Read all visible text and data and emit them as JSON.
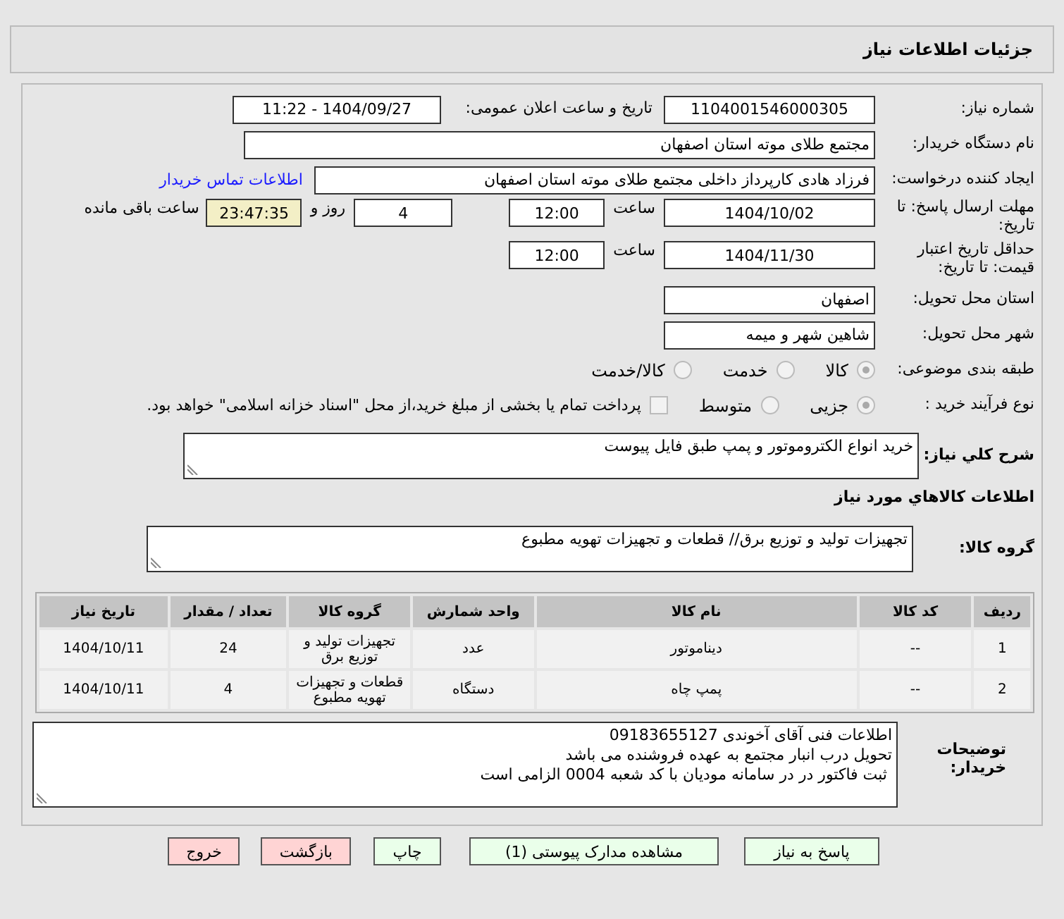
{
  "header": {
    "title": "جزئیات اطلاعات نیاز"
  },
  "need_number": {
    "label": "شماره نیاز:",
    "value": "1104001546000305"
  },
  "announce": {
    "label": "تاریخ و ساعت اعلان عمومی:",
    "value": "1404/09/27 - 11:22"
  },
  "buyer_org": {
    "label": "نام دستگاه خریدار:",
    "value": "مجتمع طلای موته استان اصفهان"
  },
  "requester": {
    "label": "ایجاد کننده درخواست:",
    "value": "فرزاد هادی کارپرداز داخلی مجتمع طلای موته استان اصفهان",
    "link": "اطلاعات تماس خریدار"
  },
  "reply_deadline": {
    "label": "مهلت ارسال پاسخ: تا تاریخ:",
    "date": "1404/10/02",
    "time_label": "ساعت",
    "time": "12:00",
    "days": "4",
    "days_label": "روز و",
    "remaining": "23:47:35",
    "remaining_label": "ساعت باقی مانده"
  },
  "price_validity": {
    "label": "حداقل تاریخ اعتبار قیمت: تا تاریخ:",
    "date": "1404/11/30",
    "time_label": "ساعت",
    "time": "12:00"
  },
  "province": {
    "label": "استان محل تحویل:",
    "value": "اصفهان"
  },
  "city": {
    "label": "شهر محل تحویل:",
    "value": "شاهین شهر و میمه"
  },
  "category": {
    "label": "طبقه بندی موضوعی:",
    "options": [
      {
        "label": "کالا",
        "selected": true
      },
      {
        "label": "خدمت",
        "selected": false
      },
      {
        "label": "کالا/خدمت",
        "selected": false
      }
    ]
  },
  "process": {
    "label": "نوع فرآیند خرید :",
    "options": [
      {
        "label": "جزیی",
        "selected": true
      },
      {
        "label": "متوسط",
        "selected": false
      }
    ],
    "treasury": {
      "label": "پرداخت تمام یا بخشی از مبلغ خرید،از محل \"اسناد خزانه اسلامی\" خواهد بود.",
      "checked": false
    }
  },
  "description": {
    "label": "شرح کلي نیاز:",
    "value": "خرید انواع الکتروموتور و پمپ طبق فایل پیوست"
  },
  "goods_section": {
    "title": "اطلاعات کالاهاي مورد نیاز"
  },
  "goods_group": {
    "label": "گروه کالا:",
    "value": "تجهیزات تولید و توزیع برق//  قطعات و تجهیزات تهویه مطبوع"
  },
  "table": {
    "columns": [
      "ردیف",
      "کد کالا",
      "نام کالا",
      "واحد شمارش",
      "گروه کالا",
      "تعداد / مقدار",
      "تاریخ نیاز"
    ],
    "rows": [
      [
        "1",
        "--",
        "دیناموتور",
        "عدد",
        "تجهیزات تولید و توزیع برق",
        "24",
        "1404/10/11"
      ],
      [
        "2",
        "--",
        "پمپ چاه",
        "دستگاه",
        "قطعات و تجهیزات تهویه مطبوع",
        "4",
        "1404/10/11"
      ]
    ]
  },
  "buyer_notes": {
    "label": "توضیحات خریدار:",
    "lines": [
      "اطلاعات فنی آقای آخوندی 09183655127",
      "تحویل درب انبار مجتمع به عهده فروشنده می باشد",
      " ثبت فاکتور در در سامانه مودیان با کد شعبه 0004 الزامی است"
    ]
  },
  "buttons": [
    {
      "label": "پاسخ به نیاز",
      "kind": "primary"
    },
    {
      "label": "مشاهده مدارک پیوستی (1)",
      "kind": "primary"
    },
    {
      "label": "چاپ",
      "kind": "primary"
    },
    {
      "label": "بازگشت",
      "kind": "danger"
    },
    {
      "label": "خروج",
      "kind": "danger"
    }
  ]
}
